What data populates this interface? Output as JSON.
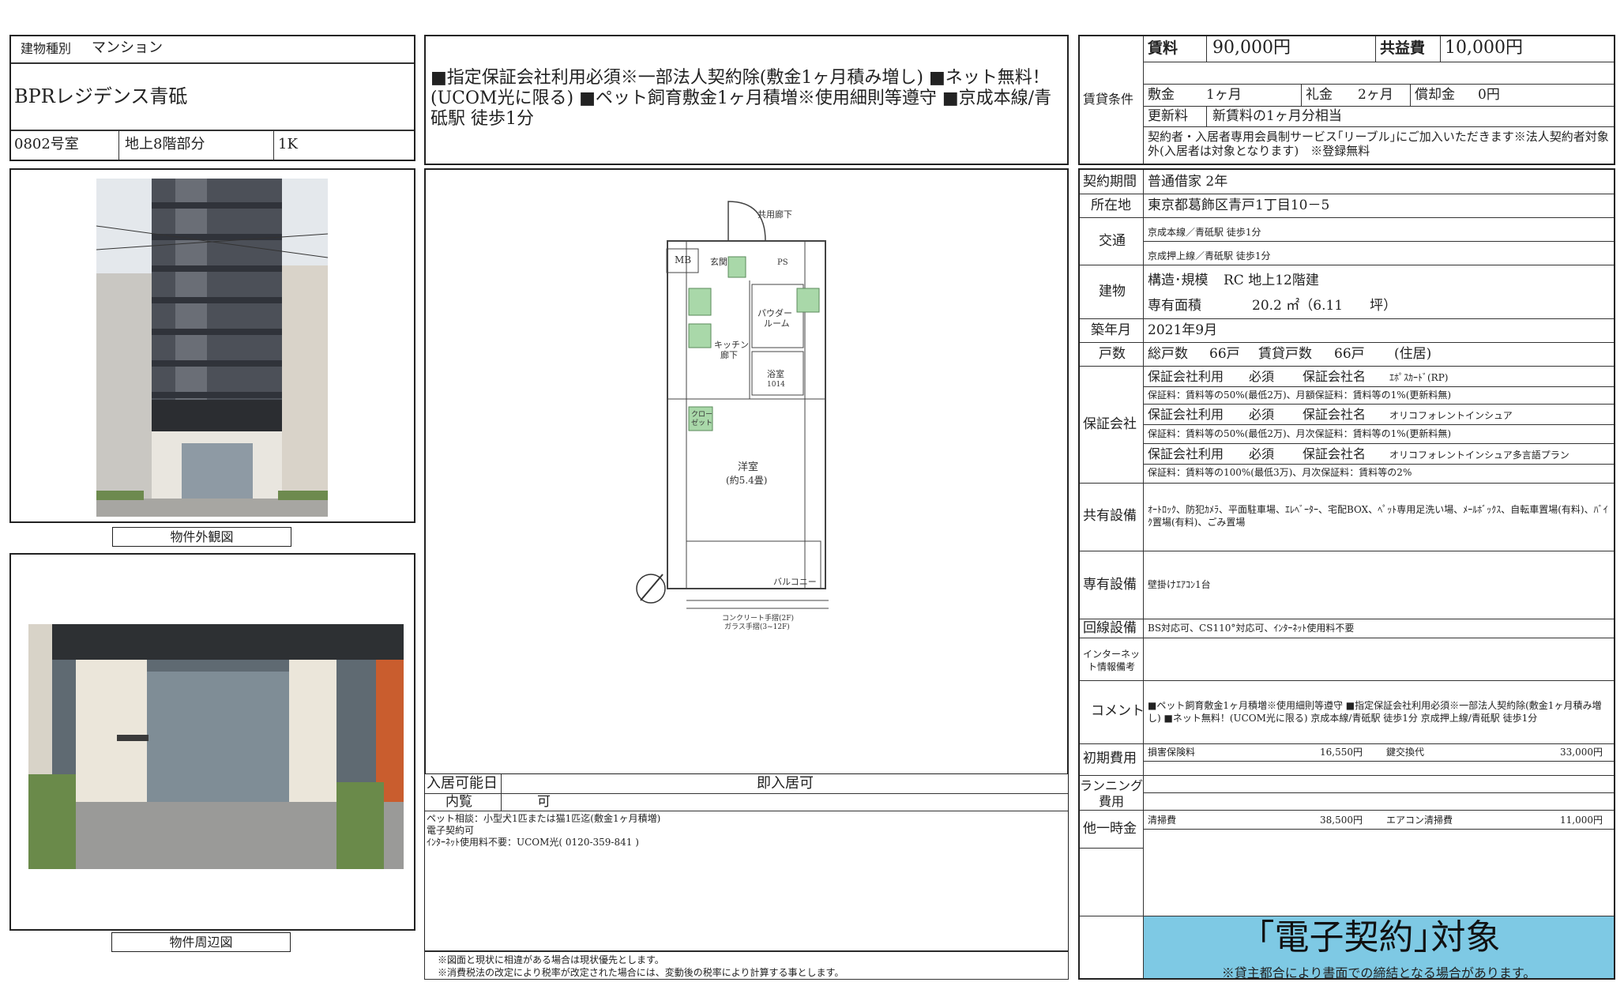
{
  "building": {
    "type_label": "建物種別",
    "type_value": "マンション",
    "name": "BPRレジデンス青砥",
    "room": "0802号室",
    "floor": "地上8階部分",
    "layout": "1K"
  },
  "headline": "■指定保証会社利用必須※一部法人契約除(敷金1ヶ月積み増し) ■ネット無料！(UCOM光に限る) ■ペット飼育敷金1ヶ月積増※使用細則等遵守 ■京成本線/青砥駅 徒歩1分",
  "photos": {
    "exterior_caption": "物件外観図",
    "surroundings_caption": "物件周辺図"
  },
  "floorplan": {
    "common_corridor": "共用廊下",
    "mb": "MB",
    "entrance": "玄関",
    "ps": "PS",
    "powder_room_1": "パウダー",
    "powder_room_2": "ルーム",
    "kitchen_1": "キッチン",
    "kitchen_2": "廊下",
    "bath_1": "浴室",
    "bath_2": "1014",
    "closet_1": "クロー",
    "closet_2": "ゼット",
    "western_room_1": "洋室",
    "western_room_2": "(約5.4畳)",
    "balcony": "バルコニー",
    "railing_note_1": "コンクリート手摺(2F)",
    "railing_note_2": "ガラス手摺(3~12F)"
  },
  "move_in": {
    "label": "入居可能日",
    "value": "即入居可",
    "viewing_label": "内覧",
    "viewing_value": "可"
  },
  "notes": [
    "ペット相談：小型犬1匹または猫1匹迄(敷金1ヶ月積増)",
    "電子契約可",
    "ｲﾝﾀｰﾈｯﾄ使用料不要：UCOM光(  0120-359-841 )"
  ],
  "disclaimers": [
    "※図面と現状に相違がある場合は現状優先とします。",
    "※消費税法の改定により税率が改定された場合には、変動後の税率により計算する事とします。"
  ],
  "rental": {
    "section_label": "賃貸条件",
    "rent_label": "賃料",
    "rent_value": "90,000円",
    "common_fee_label": "共益費",
    "common_fee_value": "10,000円",
    "deposit_label": "敷金",
    "deposit_value": "1ヶ月",
    "key_money_label": "礼金",
    "key_money_value": "2ヶ月",
    "amortization_label": "償却金",
    "amortization_value": "0円",
    "renewal_label": "更新料",
    "renewal_value": "新賃料の1ヶ月分相当",
    "membership_note": "契約者・入居者専用会員制サービス｢リーブル｣にご加入いただきます※法人契約者対象外(入居者は対象となります)　※登録無料"
  },
  "contract_period": {
    "label": "契約期間",
    "value": "普通借家 2年"
  },
  "address": {
    "label": "所在地",
    "value": "東京都葛飾区青戸1丁目10－5"
  },
  "transport": {
    "label": "交通",
    "line1": "京成本線／青砥駅 徒歩1分",
    "line2": "京成押上線／青砥駅 徒歩1分"
  },
  "structure": {
    "label": "建物",
    "structure_label": "構造･規模",
    "structure_value": "RC 地上12階建",
    "area_label": "専有面積",
    "area_value": "20.2 ㎡（6.11　　坪）"
  },
  "built": {
    "label": "築年月",
    "value": "2021年9月"
  },
  "units": {
    "label": "戸数",
    "total_label": "総戸数",
    "total_value": "66戸",
    "rental_label": "賃貸戸数",
    "rental_value": "66戸",
    "usage": "(住居)"
  },
  "guarantee": {
    "label": "保証会社",
    "entries": [
      {
        "use_label": "保証会社利用",
        "required": "必須",
        "name_label": "保証会社名",
        "name": "ｴﾎﾟｽｶｰﾄﾞ(RP)",
        "fee": "保証料：賃料等の50%(最低2万)、月額保証料：賃料等の1%(更新料無)"
      },
      {
        "use_label": "保証会社利用",
        "required": "必須",
        "name_label": "保証会社名",
        "name": "オリコフォレントインシュア",
        "fee": "保証料：賃料等の50%(最低2万)、月次保証料：賃料等の1%(更新料無)"
      },
      {
        "use_label": "保証会社利用",
        "required": "必須",
        "name_label": "保証会社名",
        "name": "オリコフォレントインシュア多言語プラン",
        "fee": "保証料：賃料等の100%(最低3万)、月次保証料：賃料等の2%"
      }
    ]
  },
  "shared_facilities": {
    "label": "共有設備",
    "value": "ｵｰﾄﾛｯｸ、防犯ｶﾒﾗ、平面駐車場、ｴﾚﾍﾞｰﾀｰ、宅配BOX、ﾍﾟｯﾄ専用足洗い場、ﾒｰﾙﾎﾞｯｸｽ、自転車置場(有料)、ﾊﾞｲｸ置場(有料)、ごみ置場"
  },
  "private_facilities": {
    "label": "専有設備",
    "value": "壁掛けｴｱｺﾝ1台"
  },
  "line_facilities": {
    "label": "回線設備",
    "value": "BS対応可、CS110°対応可、ｲﾝﾀｰﾈｯﾄ使用料不要"
  },
  "internet_notes": {
    "label": "インターネット情報備考",
    "value": ""
  },
  "comment": {
    "label": "コメント",
    "value": "■ペット飼育敷金1ヶ月積増※使用細則等遵守 ■指定保証会社利用必須※一部法人契約除(敷金1ヶ月積み増し) ■ネット無料！(UCOM光に限る) 京成本線/青砥駅 徒歩1分 京成押上線/青砥駅 徒歩1分"
  },
  "initial_costs": {
    "label": "初期費用",
    "items": [
      {
        "name": "損害保険料",
        "amount": "16,550円"
      },
      {
        "name": "鍵交換代",
        "amount": "33,000円"
      }
    ]
  },
  "running_costs": {
    "label": "ランニング費用"
  },
  "one_time": {
    "label": "他一時金",
    "items": [
      {
        "name": "清掃費",
        "amount": "38,500円"
      },
      {
        "name": "エアコン清掃費",
        "amount": "11,000円"
      }
    ]
  },
  "e_contract": {
    "title": "｢電子契約｣対象",
    "note": "※貸主都合により書面での締結となる場合があります。",
    "bg_color": "#7ec9e4"
  }
}
